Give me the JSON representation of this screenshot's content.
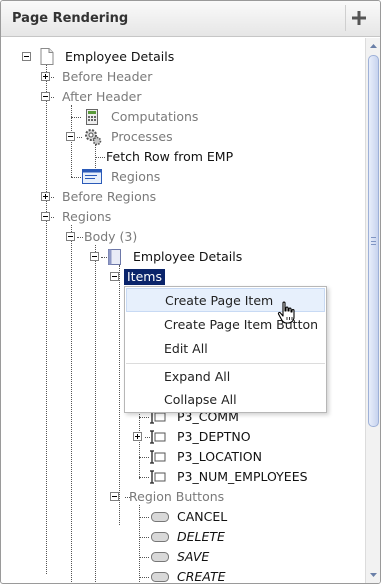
{
  "header": {
    "title": "Page Rendering",
    "add_icon": "plus-icon"
  },
  "tree": {
    "root": "Employee Details",
    "before_header": "Before Header",
    "after_header": "After Header",
    "computations": "Computations",
    "processes": "Processes",
    "fetch_row": "Fetch Row from EMP",
    "regions_sub": "Regions",
    "before_regions": "Before Regions",
    "regions": "Regions",
    "body": "Body (3)",
    "region_employee_details": "Employee Details",
    "items": "Items",
    "item_p3_comm": "P3_COMM",
    "item_p3_deptno": "P3_DEPTNO",
    "item_p3_location": "P3_LOCATION",
    "item_p3_num_employees": "P3_NUM_EMPLOYEES",
    "region_buttons": "Region Buttons",
    "btn_cancel": "CANCEL",
    "btn_delete": "DELETE",
    "btn_save": "SAVE",
    "btn_create": "CREATE"
  },
  "context_menu": {
    "items": [
      "Create Page Item",
      "Create Page Item Button",
      "Edit All",
      "Expand All",
      "Collapse All"
    ],
    "active_index": 0
  }
}
